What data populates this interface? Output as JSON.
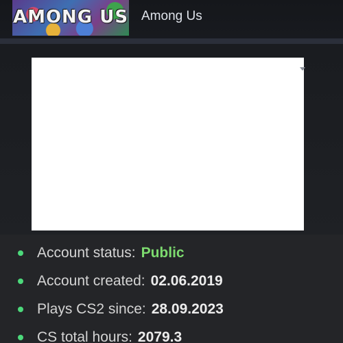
{
  "game": {
    "logo_text": "AMONG US",
    "title": "Among Us"
  },
  "info": {
    "items": [
      {
        "label": "Account status:",
        "value": "Public",
        "value_color": "#7ddb6f"
      },
      {
        "label": "Account created:",
        "value": "02.06.2019"
      },
      {
        "label": "Plays CS2 since:",
        "value": "28.09.2023"
      },
      {
        "label": "CS total hours:",
        "value": "2079.3"
      }
    ]
  },
  "colors": {
    "bullet": "#4cd97b",
    "background": "#1d1f24",
    "info_background": "#242528"
  }
}
